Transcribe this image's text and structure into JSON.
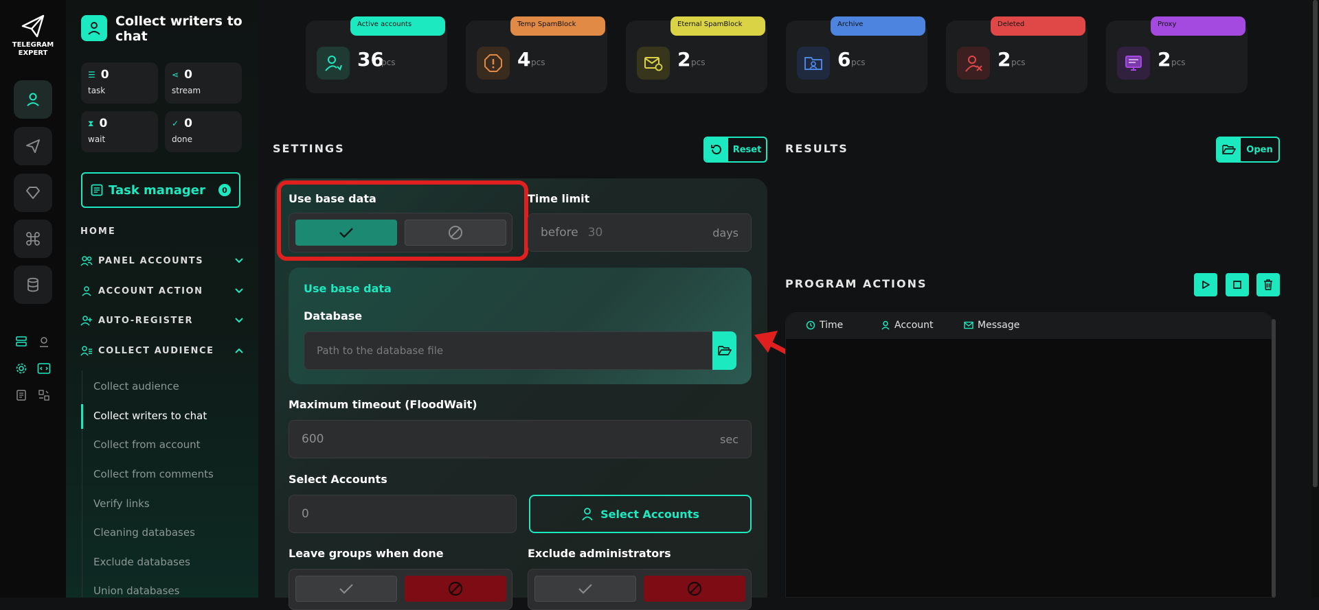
{
  "app": {
    "name_line1": "TELEGRAM",
    "name_line2": "EXPERT"
  },
  "side": {
    "title": "Collect writers to chat",
    "stats": [
      {
        "value": "0",
        "label": "task"
      },
      {
        "value": "0",
        "label": "stream"
      },
      {
        "value": "0",
        "label": "wait"
      },
      {
        "value": "0",
        "label": "done"
      }
    ],
    "task_manager": {
      "label": "Task manager",
      "count": "0"
    },
    "home": "HOME",
    "sections": [
      {
        "label": "PANEL ACCOUNTS"
      },
      {
        "label": "ACCOUNT ACTION"
      },
      {
        "label": "AUTO-REGISTER"
      },
      {
        "label": "COLLECT AUDIENCE"
      }
    ],
    "sub_items": [
      "Collect audience",
      "Collect writers to chat",
      "Collect from account",
      "Collect from comments",
      "Verify links",
      "Cleaning databases",
      "Exclude databases",
      "Union databases"
    ]
  },
  "cards": [
    {
      "tag": "Active accounts",
      "value": "36",
      "unit": "pcs",
      "color": "#1de9c1"
    },
    {
      "tag": "Temp SpamBlock",
      "value": "4",
      "unit": "pcs",
      "color": "#e08a45"
    },
    {
      "tag": "Eternal SpamBlock",
      "value": "2",
      "unit": "pcs",
      "color": "#d9d345"
    },
    {
      "tag": "Archive",
      "value": "6",
      "unit": "pcs",
      "color": "#4c84e0"
    },
    {
      "tag": "Deleted",
      "value": "2",
      "unit": "pcs",
      "color": "#e04848"
    },
    {
      "tag": "Proxy",
      "value": "2",
      "unit": "pcs",
      "color": "#a44ae0"
    }
  ],
  "settings": {
    "heading": "SETTINGS",
    "reset_label": "Reset",
    "use_base_data_label": "Use base data",
    "time_limit": {
      "label": "Time limit",
      "prefix": "before",
      "value": "30",
      "suffix": "days"
    },
    "db_box": {
      "title": "Use base data",
      "database_label": "Database",
      "placeholder": "Path to the database file"
    },
    "timeout": {
      "label": "Maximum timeout (FloodWait)",
      "value": "600",
      "suffix": "sec"
    },
    "select_accounts": {
      "label": "Select Accounts",
      "value": "0",
      "button": "Select Accounts"
    },
    "leave_groups_label": "Leave groups when done",
    "exclude_admins_label": "Exclude administrators"
  },
  "results": {
    "heading": "RESULTS",
    "open_label": "Open"
  },
  "program_actions": {
    "heading": "PROGRAM ACTIONS",
    "columns": [
      "Time",
      "Account",
      "Message"
    ]
  }
}
